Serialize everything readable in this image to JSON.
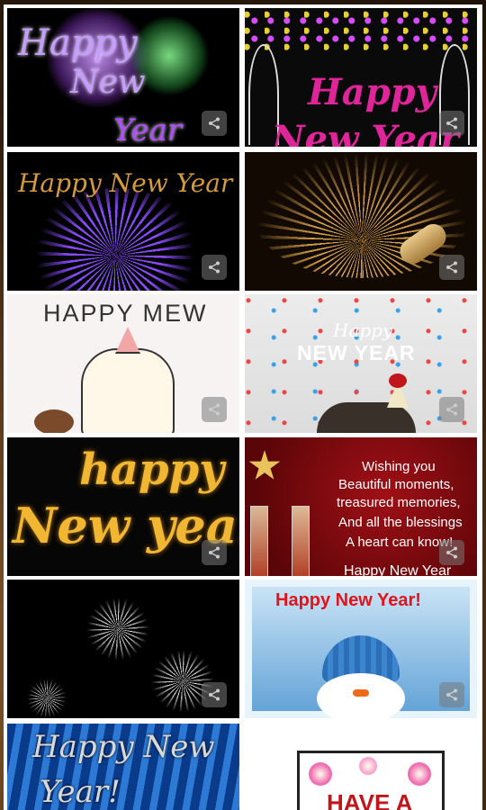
{
  "cards": [
    {
      "id": "c1",
      "lines": [
        "Happy",
        "New",
        "Year"
      ]
    },
    {
      "id": "c2",
      "lines": [
        "Happy",
        "New Year"
      ]
    },
    {
      "id": "c3",
      "lines": [
        "Happy New Year"
      ]
    },
    {
      "id": "c4",
      "lines": []
    },
    {
      "id": "c5",
      "lines": [
        "HAPPY MEW"
      ]
    },
    {
      "id": "c6",
      "lines": [
        "Happy",
        "NEW YEAR"
      ]
    },
    {
      "id": "c7",
      "lines": [
        "happy",
        "New year"
      ]
    },
    {
      "id": "c8",
      "lines": [
        "Wishing you",
        "Beautiful moments,",
        "treasured memories,",
        "And all the blessings",
        "A heart can know!",
        "Happy New Year"
      ]
    },
    {
      "id": "c9",
      "lines": []
    },
    {
      "id": "c10",
      "lines": [
        "Happy New Year!"
      ]
    },
    {
      "id": "c11",
      "lines": [
        "Happy New",
        "Year!"
      ]
    },
    {
      "id": "c12",
      "lines": [
        "HAVE A"
      ]
    }
  ],
  "share_icon": "share-icon",
  "colors": {
    "background": "#ffffff",
    "purple": "#b04cff",
    "gold": "#f2b732",
    "red": "#c0151b",
    "pink": "#e0259b"
  }
}
